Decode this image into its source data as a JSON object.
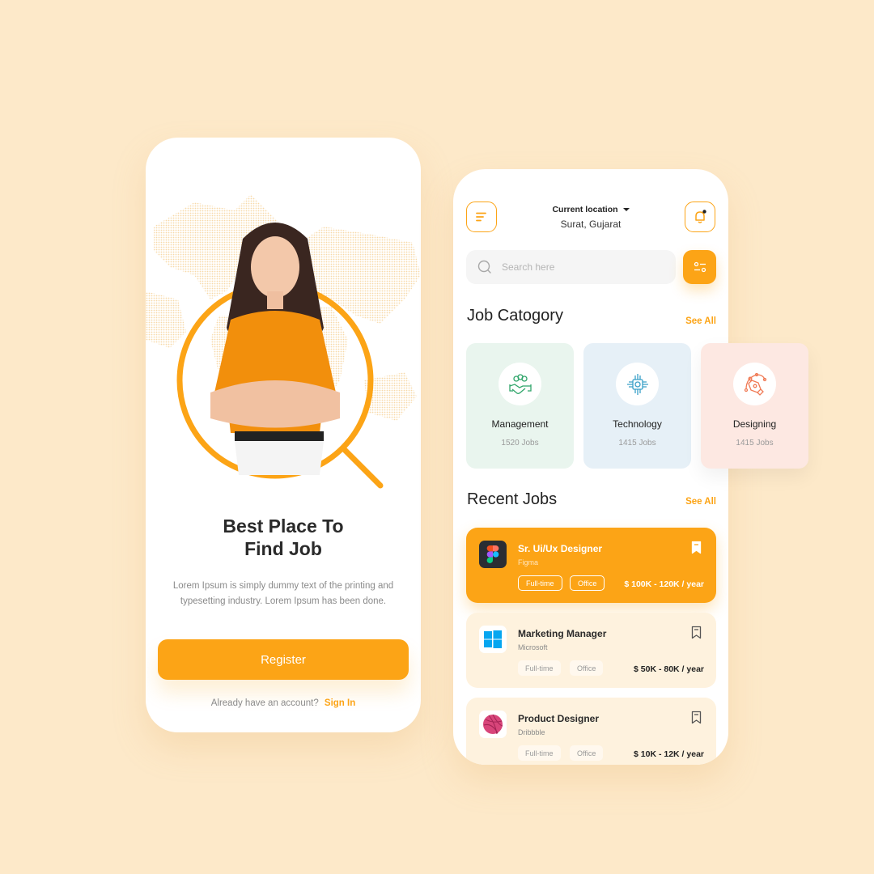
{
  "onboarding": {
    "title_line1": "Best Place To",
    "title_line2": "Find Job",
    "description": "Lorem Ipsum is simply dummy text of the printing and typesetting industry. Lorem Ipsum has been done.",
    "register_label": "Register",
    "signin_prompt": "Already have an account?",
    "signin_link": "Sign In",
    "hero_image": "woman-in-orange-tshirt-in-magnifier",
    "background_graphic": "dotted-world-map"
  },
  "home": {
    "header": {
      "menu_icon": "menu-icon",
      "location_label": "Current location",
      "location_value": "Surat, Gujarat",
      "notification_icon": "bell-icon"
    },
    "search": {
      "placeholder": "Search here",
      "value": "",
      "filter_icon": "filter-icon"
    },
    "categories": {
      "title": "Job Catogory",
      "see_all": "See All",
      "items": [
        {
          "name": "Management",
          "count": "1520 Jobs",
          "icon": "handshake-icon",
          "color": "#2fa56a",
          "bg": "#e9f5ee"
        },
        {
          "name": "Technology",
          "count": "1415 Jobs",
          "icon": "chip-icon",
          "color": "#3aa0c8",
          "bg": "#e6f0f7"
        },
        {
          "name": "Designing",
          "count": "1415 Jobs",
          "icon": "pen-tool-icon",
          "color": "#f07a55",
          "bg": "#fde8e2"
        }
      ]
    },
    "recent_jobs": {
      "title": "Recent Jobs",
      "see_all": "See All",
      "items": [
        {
          "title": "Sr. Ui/Ux Designer",
          "company": "Figma",
          "tags": [
            "Full-time",
            "Office"
          ],
          "salary": "$ 100K - 120K / year",
          "logo": "figma-logo",
          "active": true
        },
        {
          "title": "Marketing Manager",
          "company": "Microsoft",
          "tags": [
            "Full-time",
            "Office"
          ],
          "salary": "$ 50K - 80K / year",
          "logo": "windows-logo",
          "active": false
        },
        {
          "title": "Product Designer",
          "company": "Dribbble",
          "tags": [
            "Full-time",
            "Office"
          ],
          "salary": "$ 10K - 12K / year",
          "logo": "dribbble-logo",
          "active": false
        }
      ]
    }
  },
  "colors": {
    "accent": "#fca416",
    "background": "#fde9c9",
    "card_light": "#fef2de"
  }
}
